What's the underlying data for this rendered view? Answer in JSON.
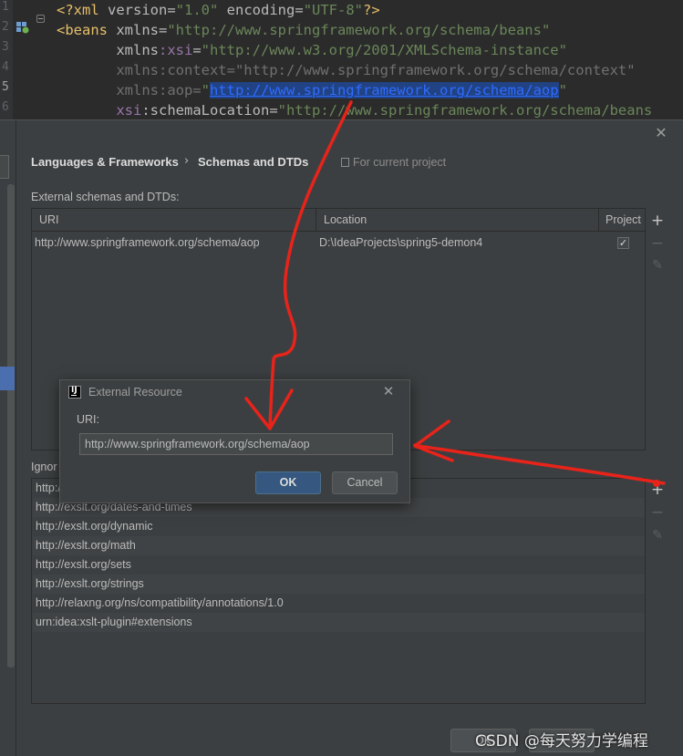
{
  "editor": {
    "line_numbers": [
      "1",
      "2",
      "3",
      "4",
      "5",
      "6"
    ],
    "lines": [
      {
        "parts": [
          {
            "t": "<?xml ",
            "c": "t-tag"
          },
          {
            "t": "version",
            "c": "t-attr"
          },
          {
            "t": "=",
            "c": "t-attr"
          },
          {
            "t": "\"1.0\"",
            "c": "t-str"
          },
          {
            "t": " encoding",
            "c": "t-attr"
          },
          {
            "t": "=",
            "c": "t-attr"
          },
          {
            "t": "\"UTF-8\"",
            "c": "t-str"
          },
          {
            "t": "?>",
            "c": "t-tag"
          }
        ]
      },
      {
        "parts": [
          {
            "t": "<beans ",
            "c": "t-tag"
          },
          {
            "t": "xmlns",
            "c": "t-attr"
          },
          {
            "t": "=",
            "c": "t-attr"
          },
          {
            "t": "\"http://www.springframework.org/schema/beans\"",
            "c": "t-str"
          }
        ]
      },
      {
        "parts": [
          {
            "t": "       xmlns",
            "c": "t-attr"
          },
          {
            "t": ":xsi",
            "c": "t-ns"
          },
          {
            "t": "=",
            "c": "t-attr"
          },
          {
            "t": "\"http://www.w3.org/2001/XMLSchema-instance\"",
            "c": "t-str"
          }
        ]
      },
      {
        "parts": [
          {
            "t": "       xmlns:context=",
            "c": "t-attr-g"
          },
          {
            "t": "\"http://www.springframework.org/schema/context\"",
            "c": "t-str-g"
          }
        ]
      },
      {
        "parts": [
          {
            "t": "       xmlns:aop=",
            "c": "t-attr-g"
          },
          {
            "t": "\"",
            "c": "t-str"
          },
          {
            "t": "http://www.springframework.org/schema/aop",
            "c": "t-sel"
          },
          {
            "t": "\"",
            "c": "t-str"
          }
        ]
      },
      {
        "parts": [
          {
            "t": "       xsi",
            "c": "t-ns"
          },
          {
            "t": ":schemaLocation",
            "c": "t-attr"
          },
          {
            "t": "=",
            "c": "t-attr"
          },
          {
            "t": "\"http://www.springframework.org/schema/beans",
            "c": "t-str"
          }
        ]
      }
    ]
  },
  "settings": {
    "breadcrumb": [
      "Languages & Frameworks",
      "Schemas and DTDs"
    ],
    "breadcrumb_separator": "›",
    "scope_label": "For current project",
    "close_icon": "✕",
    "external": {
      "label": "External schemas and DTDs:",
      "columns": [
        "URI",
        "Location",
        "Project"
      ],
      "rows": [
        {
          "uri": "http://www.springframework.org/schema/aop",
          "location": "D:\\IdeaProjects\\spring5-demon4",
          "project_checked": true
        }
      ]
    },
    "ignored": {
      "label": "Ignor",
      "rows": [
        "http://",
        "http://exslt.org/dates-and-times",
        "http://exslt.org/dynamic",
        "http://exslt.org/math",
        "http://exslt.org/sets",
        "http://exslt.org/strings",
        "http://relaxng.org/ns/compatibility/annotations/1.0",
        "urn:idea:xslt-plugin#extensions"
      ]
    },
    "tools": {
      "add": "+",
      "remove": "−",
      "edit": "✎"
    },
    "bottom_ok": "OK"
  },
  "external_resource_dialog": {
    "title": "External Resource",
    "logo_text": "IJ",
    "uri_label": "URI:",
    "uri_value": "http://www.springframework.org/schema/aop",
    "ok_label": "OK",
    "cancel_label": "Cancel",
    "close_icon": "✕"
  },
  "annotations": {
    "arrow_color": "#e8231a",
    "watermark": "CSDN @每天努力学编程"
  }
}
